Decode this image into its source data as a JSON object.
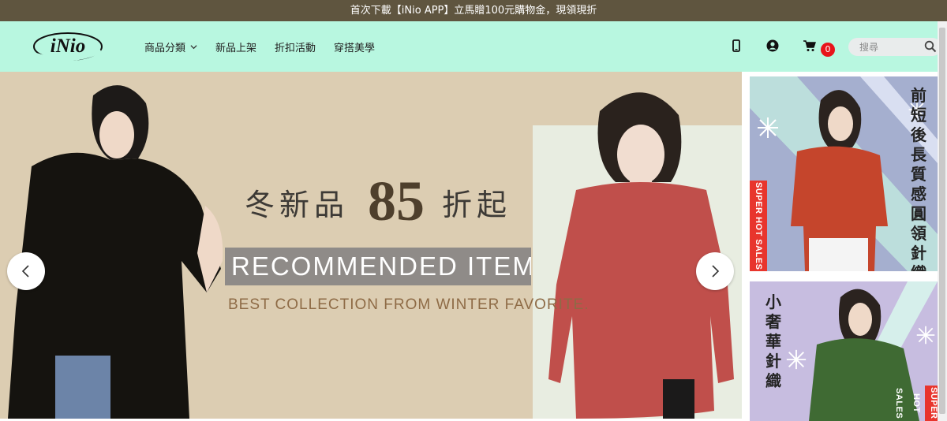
{
  "promo_bar": {
    "text": "首次下載【iNio APP】立馬贈100元購物金，現領現折"
  },
  "header": {
    "logo_text": "iNio",
    "nav": [
      {
        "label": "商品分類",
        "has_dropdown": true
      },
      {
        "label": "新品上架"
      },
      {
        "label": "折扣活動"
      },
      {
        "label": "穿搭美學"
      }
    ],
    "icons": [
      "mobile-icon",
      "user-icon",
      "cart-icon"
    ],
    "cart_count": "0",
    "search_placeholder": "搜尋"
  },
  "banner": {
    "headline_prefix": "冬新品",
    "headline_number": "85",
    "headline_suffix": "折起",
    "recommended": "RECOMMENDED ITEMS",
    "subtitle": "BEST COLLECTION FROM WINTER FAVORITE."
  },
  "side_cards": [
    {
      "title": "前短後長質感圓領針織毛衣",
      "tag": "SUPER HOT SALES",
      "bg": "#a5afcf",
      "sweater": "#c5452c"
    },
    {
      "title": "小奢華針織",
      "tag": "SUPER HOT SALES",
      "bg": "#c7bde0",
      "sweater": "#3f6a33"
    }
  ],
  "colors": {
    "promo_bg": "#5f553f",
    "header_bg": "#b8f7e0",
    "badge": "#e8141b",
    "banner_bg": "#dccdb2"
  }
}
